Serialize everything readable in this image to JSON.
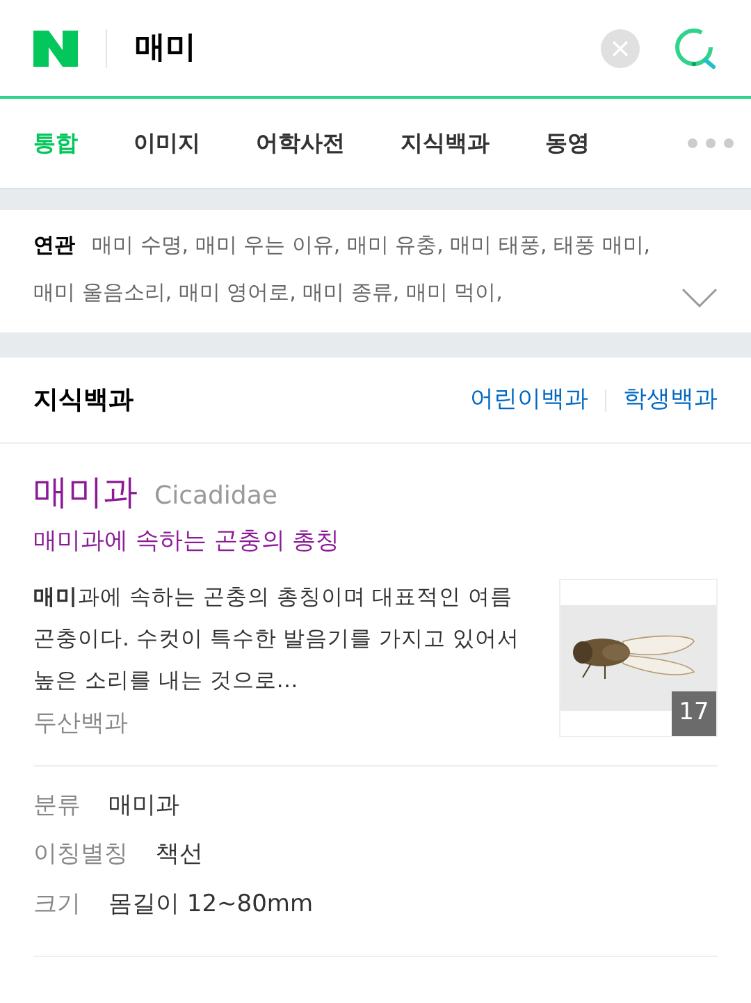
{
  "search": {
    "value": "매미"
  },
  "tabs": [
    {
      "label": "통합",
      "selected": true
    },
    {
      "label": "이미지",
      "selected": false
    },
    {
      "label": "어학사전",
      "selected": false
    },
    {
      "label": "지식백과",
      "selected": false
    },
    {
      "label": "동영",
      "selected": false
    }
  ],
  "related": {
    "label": "연관",
    "text": "매미 수명, 매미 우는 이유, 매미 유충, 매미 태풍, 태풍 매미, 매미 울음소리, 매미 영어로, 매미 종류, 매미 먹이,"
  },
  "section": {
    "title": "지식백과",
    "links": [
      "어린이백과",
      "학생백과"
    ]
  },
  "entry": {
    "title": "매미과",
    "latin": "Cicadidae",
    "subtitle": "매미과에 속하는 곤충의 총칭",
    "description": "**매미**과에 속하는 곤충의 총칭이며 대표적인 여름곤충이다. 수컷이 특수한 발음기를 가지고 있어서 높은 소리를 내는 것으로…",
    "source": "두산백과",
    "image": {
      "kind": "picture",
      "count": "17"
    }
  },
  "facts": [
    {
      "label": "분류",
      "value": "매미과"
    },
    {
      "label": "이칭별칭",
      "value": "책선"
    },
    {
      "label": "크기",
      "value": "몸길이 12~80mm"
    }
  ]
}
